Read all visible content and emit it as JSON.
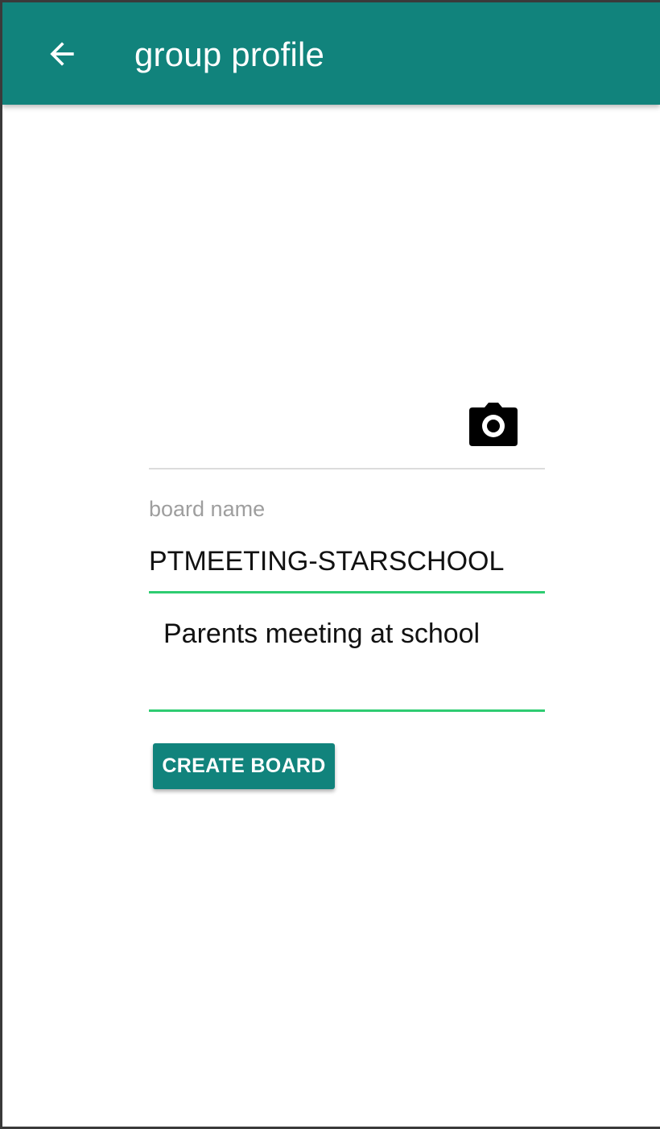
{
  "app_bar": {
    "title": "group profile",
    "back_icon": "arrow-left-icon",
    "background_color": "#11837c"
  },
  "avatar": {
    "camera_icon": "camera-icon"
  },
  "form": {
    "board_name": {
      "label": "board name",
      "value": "PTMEETING-STARSCHOOL"
    },
    "description": {
      "value": "Parents meeting at school"
    },
    "underline_color": "#2ecc71"
  },
  "actions": {
    "create_label": "CREATE BOARD"
  }
}
